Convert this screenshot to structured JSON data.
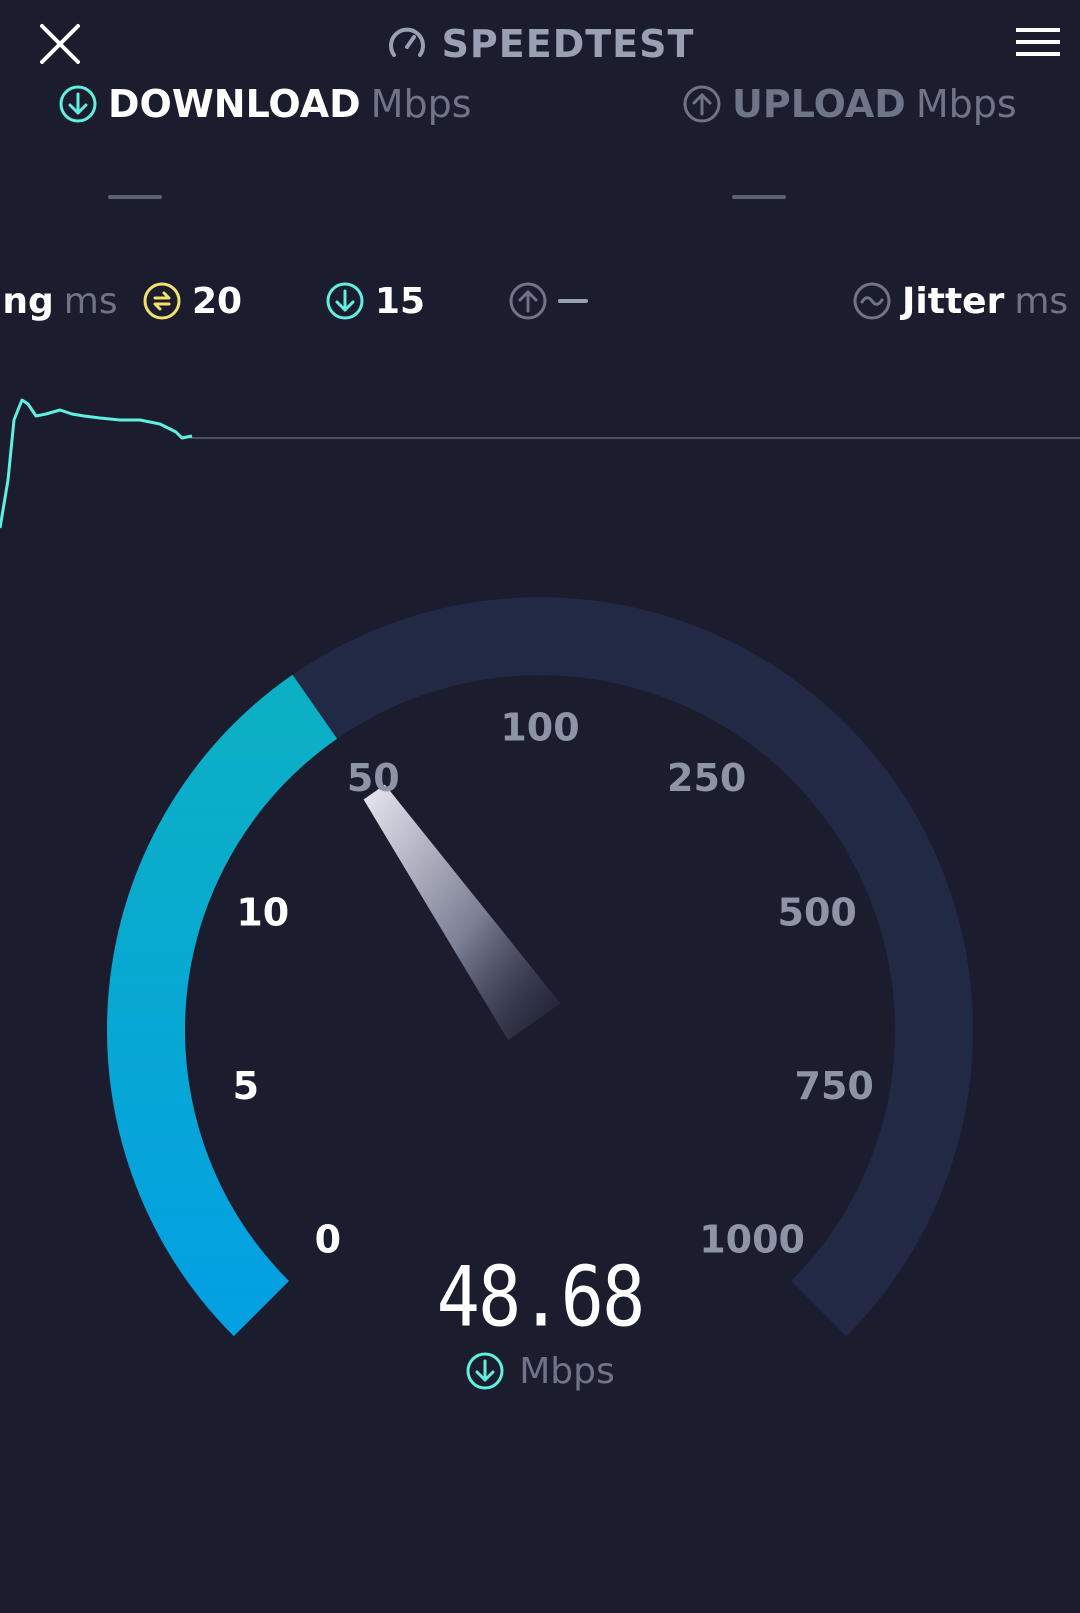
{
  "header": {
    "brand": "SPEEDTEST",
    "close_icon": "close-icon",
    "menu_icon": "hamburger-menu-icon",
    "brand_icon": "speedometer-icon"
  },
  "download": {
    "label": "DOWNLOAD",
    "unit": "Mbps",
    "icon": "download-arrow-icon",
    "value": "—"
  },
  "upload": {
    "label": "UPLOAD",
    "unit": "Mbps",
    "icon": "upload-arrow-icon",
    "value": "—"
  },
  "ping": {
    "label": "ing",
    "unit": "ms",
    "idle_value": "20",
    "download_value": "15",
    "upload_value": "—"
  },
  "jitter": {
    "label": "Jitter",
    "unit": "ms"
  },
  "gauge": {
    "labels": [
      "0",
      "5",
      "10",
      "50",
      "100",
      "250",
      "500",
      "750",
      "1000"
    ],
    "current_value": 48.68
  },
  "readout": {
    "value": "48.68",
    "unit": "Mbps"
  },
  "colors": {
    "background": "#1b1c2e",
    "accent_cyan": "#5ff0e0",
    "gauge_fill": "#07a3d9",
    "gauge_track": "#212944",
    "ping_yellow": "#f0e26a"
  }
}
